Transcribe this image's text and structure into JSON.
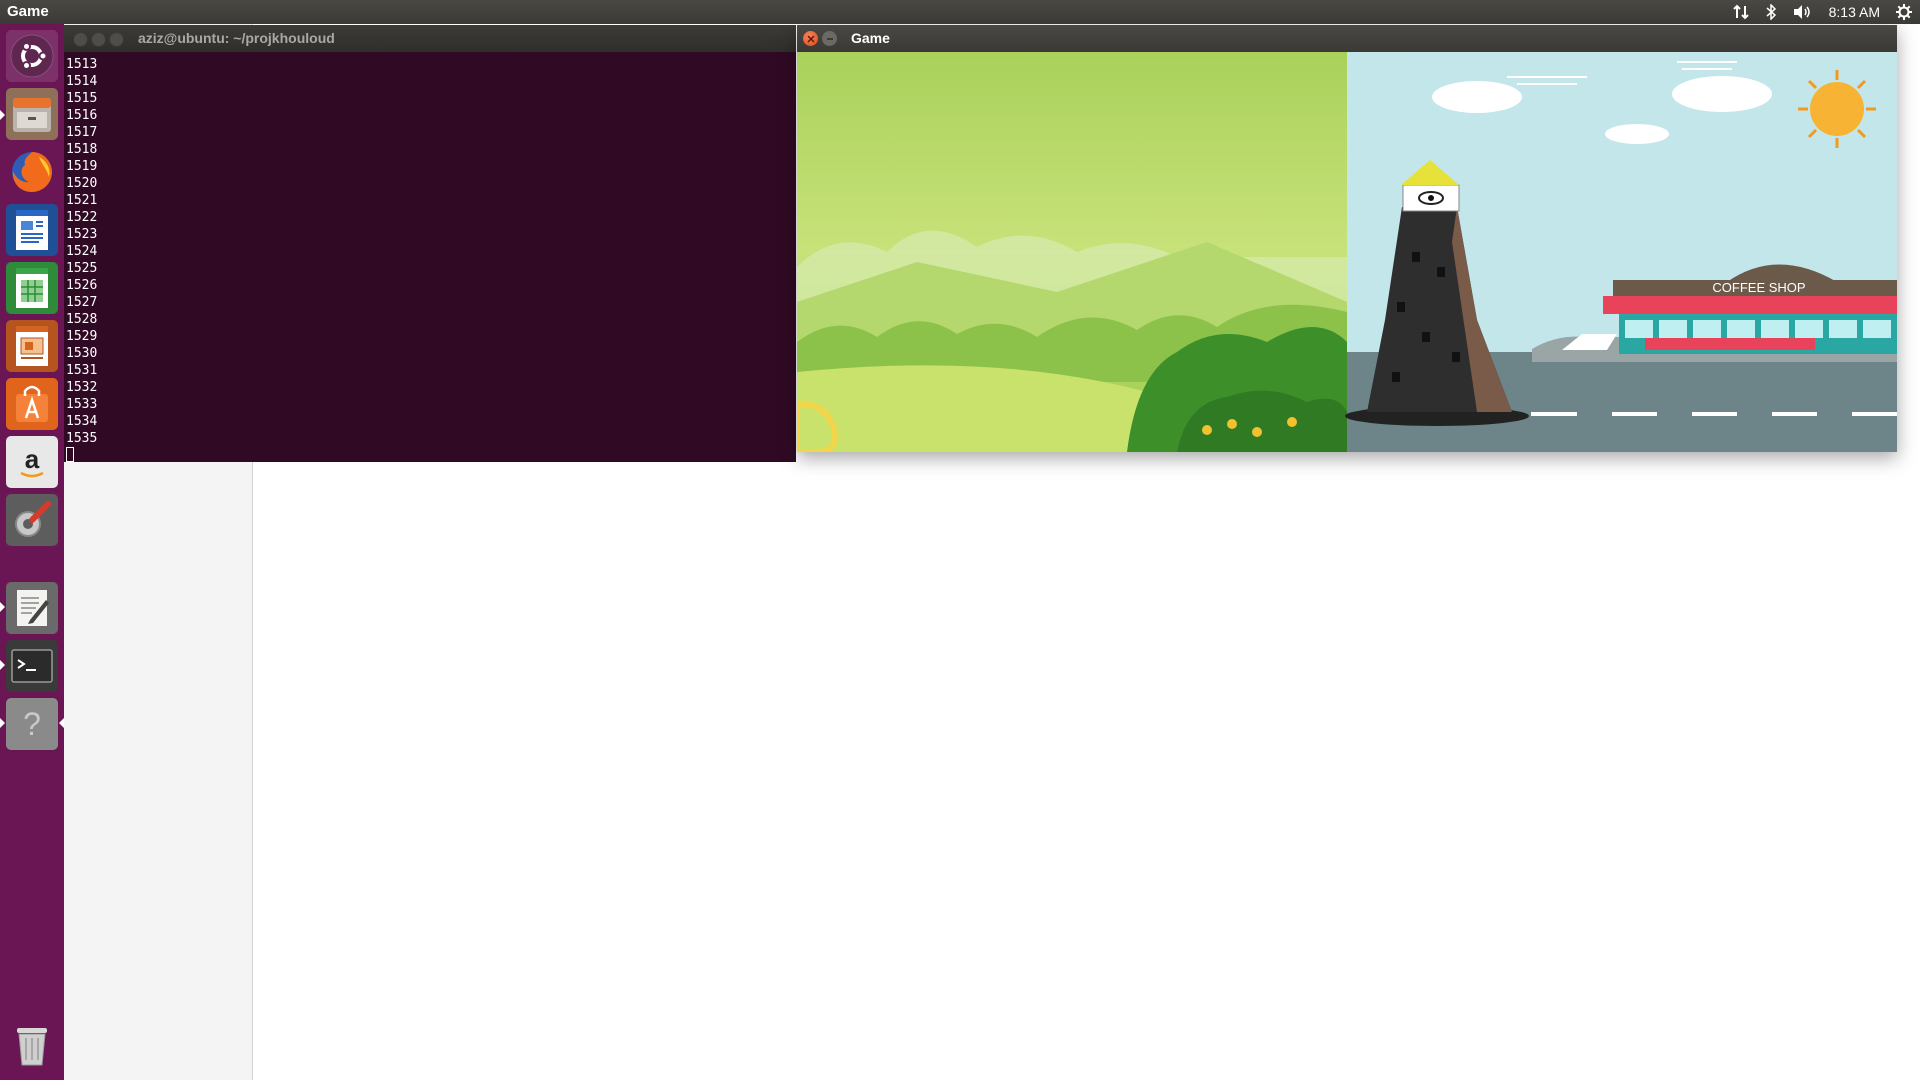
{
  "top_panel": {
    "app_name": "Game",
    "clock": "8:13 AM",
    "indicator_icons": [
      "network-icon",
      "bluetooth-icon",
      "volume-icon",
      "settings-gear-icon"
    ]
  },
  "launcher": {
    "items": [
      {
        "name": "ubuntu-dash",
        "icon": "ubuntu-logo-icon"
      },
      {
        "name": "files",
        "icon": "file-cabinet-icon"
      },
      {
        "name": "firefox",
        "icon": "firefox-icon"
      },
      {
        "name": "libreoffice-writer",
        "icon": "writer-document-icon"
      },
      {
        "name": "libreoffice-calc",
        "icon": "calc-spreadsheet-icon"
      },
      {
        "name": "libreoffice-impress",
        "icon": "impress-presentation-icon"
      },
      {
        "name": "ubuntu-software",
        "icon": "software-bag-icon"
      },
      {
        "name": "amazon",
        "icon": "amazon-icon"
      },
      {
        "name": "system-settings",
        "icon": "settings-wrench-icon"
      },
      {
        "name": "text-editor",
        "icon": "text-editor-icon"
      },
      {
        "name": "terminal",
        "icon": "terminal-icon"
      },
      {
        "name": "unknown-app",
        "icon": "question-mark-icon"
      },
      {
        "name": "trash",
        "icon": "trash-icon"
      }
    ]
  },
  "terminal": {
    "title": "aziz@ubuntu: ~/projkhouloud",
    "lines": [
      "1513",
      "1514",
      "1515",
      "1516",
      "1517",
      "1518",
      "1519",
      "1520",
      "1521",
      "1522",
      "1523",
      "1524",
      "1525",
      "1526",
      "1527",
      "1528",
      "1529",
      "1530",
      "1531",
      "1532",
      "1533",
      "1534",
      "1535"
    ]
  },
  "game_window": {
    "title": "Game",
    "shop_sign": "COFFEE SHOP",
    "colors": {
      "grass": "#a9d15a",
      "sky": "#c3e6ea",
      "road": "#6d8488",
      "tower": "#2e2e2e",
      "sun": "#f7b334"
    }
  }
}
